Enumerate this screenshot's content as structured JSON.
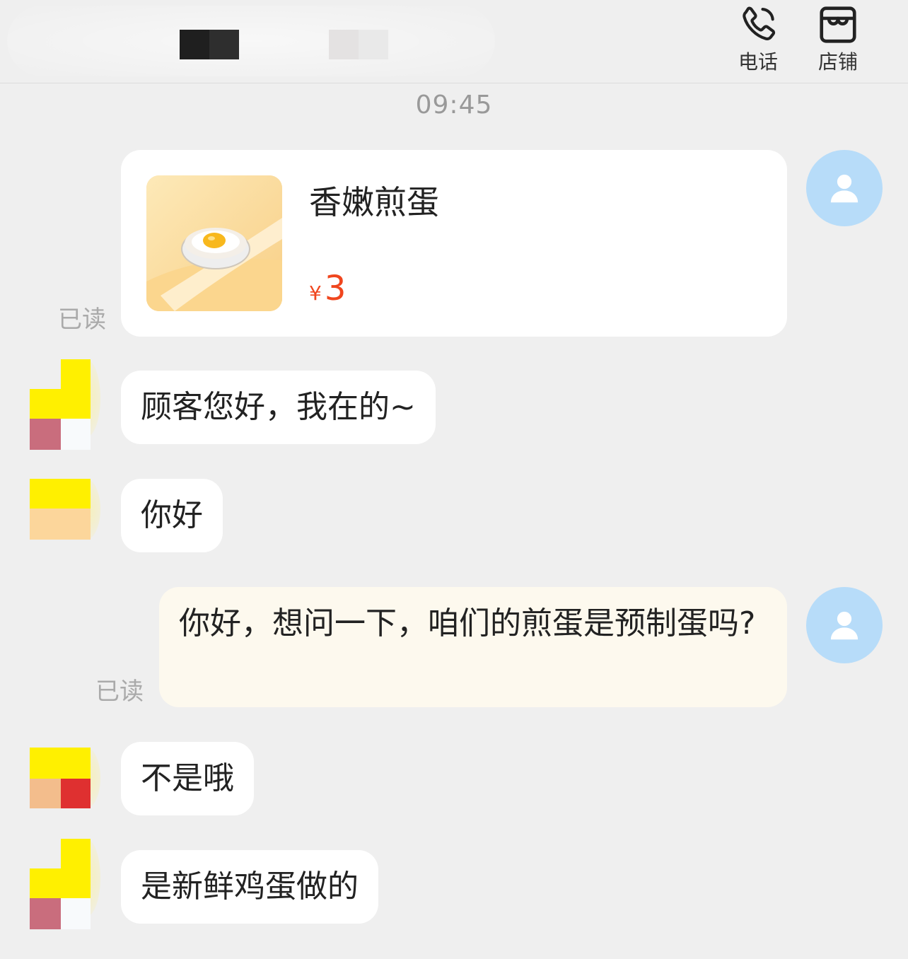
{
  "header": {
    "phone_label": "电话",
    "store_label": "店铺"
  },
  "timestamp": "09:45",
  "product": {
    "name": "香嫩煎蛋",
    "currency": "¥",
    "price": "3"
  },
  "read_label": "已读",
  "messages": [
    {
      "from": "shop",
      "text": "顾客您好，我在的~"
    },
    {
      "from": "shop",
      "text": "你好"
    },
    {
      "from": "me",
      "text": "你好，想问一下，咱们的煎蛋是预制蛋吗?"
    },
    {
      "from": "shop",
      "text": "不是哦"
    },
    {
      "from": "shop",
      "text": "是新鲜鸡蛋做的"
    }
  ],
  "colors": {
    "background": "#efefef",
    "price_red": "#f0461e",
    "self_avatar": "#b7dcf9",
    "my_bubble": "#fdf9ee"
  }
}
